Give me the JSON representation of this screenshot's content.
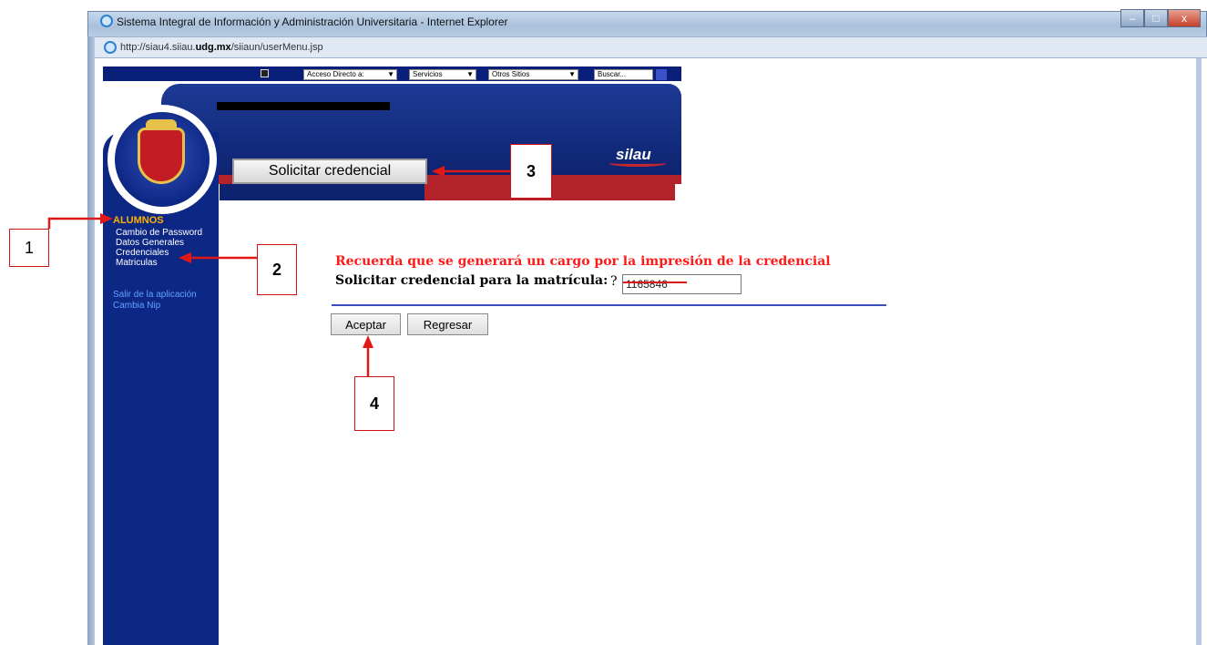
{
  "window": {
    "title": "Sistema Integral de Información y Administración Universitaria - Internet Explorer",
    "controls": [
      "–",
      "□",
      "x"
    ],
    "url_prefix": "http://siau4.siiau.",
    "url_domain": "udg.mx",
    "url_path": "/siiaun/userMenu.jsp"
  },
  "topnav": {
    "acceso": "Acceso Directo a:",
    "servicios": "Servicios",
    "otros": "Otros Sitios",
    "buscar": "Buscar..."
  },
  "banner": {
    "button_label": "Solicitar credencial",
    "logo_text": "silau"
  },
  "sidebar": {
    "heading": "ALUMNOS",
    "items": [
      "Cambio de Password",
      "Datos Generales",
      "Credenciales",
      "Matriculas"
    ],
    "links": [
      "Salir de la aplicación",
      "Cambia Nip"
    ]
  },
  "main": {
    "warning": "Recuerda que se generará un cargo por la impresión de la credencial",
    "label": "Solicitar credencial para la matrícula:",
    "help": "?",
    "matricula_value": "1165846",
    "accept_label": "Aceptar",
    "back_label": "Regresar"
  },
  "annotations": [
    "1",
    "2",
    "3",
    "4"
  ],
  "colors": {
    "nav_blue": "#0d2785",
    "accent_red": "#c21d22",
    "warning_red": "#ff1a1a",
    "heading_orange": "#ffb000"
  }
}
